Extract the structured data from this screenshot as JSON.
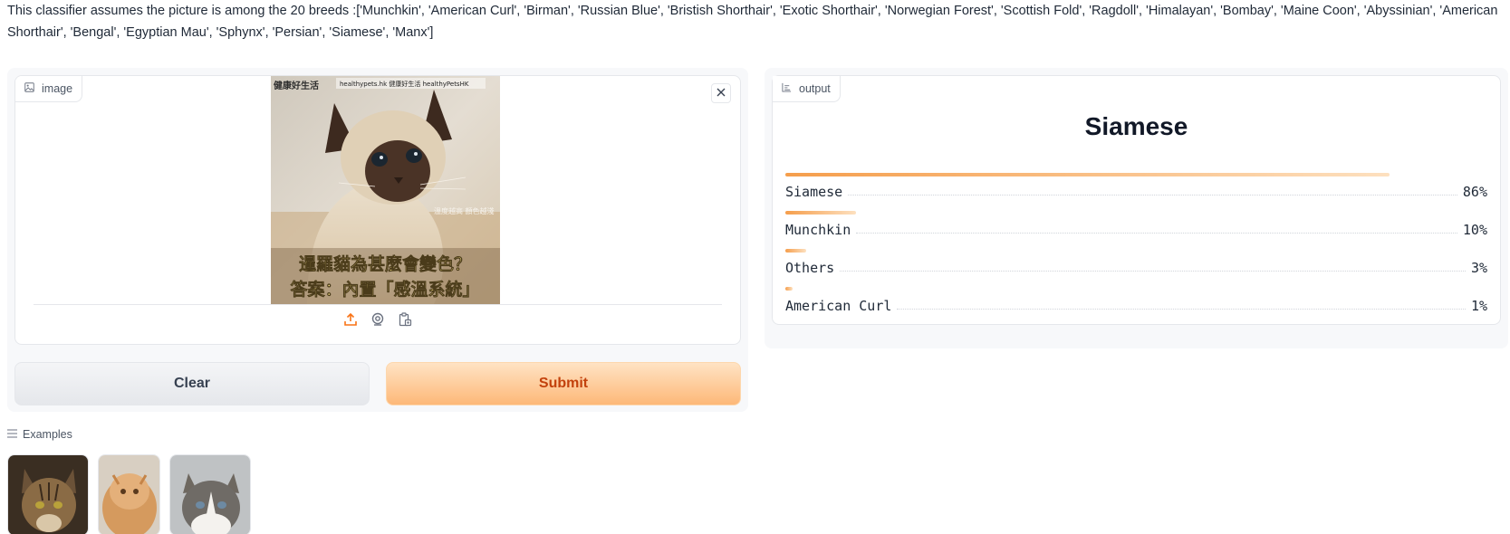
{
  "description": "This classifier assumes the picture is among the 20 breeds :['Munchkin', 'American Curl', 'Birman', 'Russian Blue', 'Bristish Shorthair', 'Exotic Shorthair', 'Norwegian Forest', 'Scottish Fold', 'Ragdoll', 'Himalayan', 'Bombay', 'Maine Coon', 'Abyssinian', 'American Shorthair', 'Bengal', 'Egyptian Mau', 'Sphynx', 'Persian', 'Siamese', 'Manx']",
  "input": {
    "label": "image",
    "label_icon": "image-icon",
    "close_icon": "close-icon",
    "photo": {
      "top_left_text": "健康好生活",
      "top_bar_text": "healthypets.hk  健康好生活 healthyPetsHK",
      "side_caption": "溫度越高 顏色越淺",
      "caption_line1": "暹羅貓為甚麼會變色？",
      "caption_line2": "答案：內置「感溫系統」"
    },
    "toolbar": [
      "upload-icon",
      "webcam-icon",
      "clipboard-icon"
    ]
  },
  "buttons": {
    "clear": "Clear",
    "submit": "Submit"
  },
  "output": {
    "label": "output",
    "label_icon": "chart-icon",
    "title": "Siamese",
    "confidences": [
      {
        "label": "Siamese",
        "percent": "86%",
        "value": 0.86
      },
      {
        "label": "Munchkin",
        "percent": "10%",
        "value": 0.1
      },
      {
        "label": "Others",
        "percent": "3%",
        "value": 0.03
      },
      {
        "label": "American Curl",
        "percent": "1%",
        "value": 0.01
      }
    ]
  },
  "examples": {
    "label": "Examples",
    "label_icon": "list-icon",
    "items": [
      "maine-coon-thumbnail",
      "persian-thumbnail",
      "ragdoll-thumbnail"
    ]
  },
  "colors": {
    "accent": "#f97316",
    "submit_bg": "#fdb878",
    "bar_start": "#f59e4c"
  }
}
